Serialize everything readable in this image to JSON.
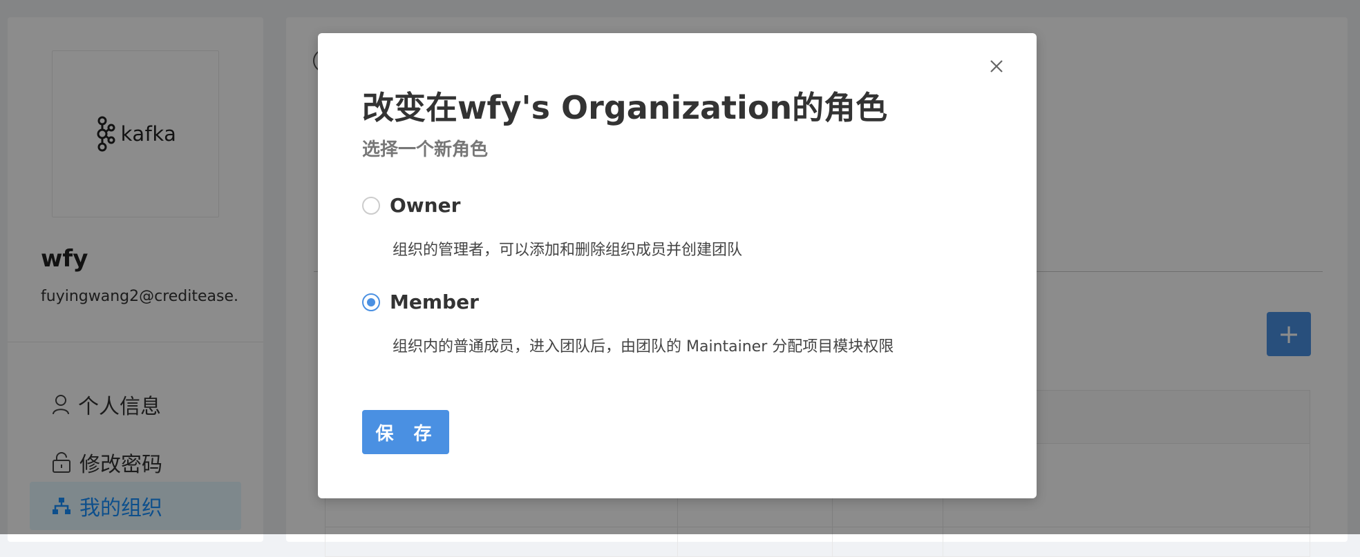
{
  "sidebar": {
    "logo_text": "kafka",
    "user_name": "wfy",
    "user_email": "fuyingwang2@creditease.",
    "items": [
      {
        "label": "个人信息",
        "icon": "user-icon"
      },
      {
        "label": "修改密码",
        "icon": "lock-icon"
      },
      {
        "label": "我的组织",
        "icon": "organization-icon",
        "active": true
      }
    ]
  },
  "main": {
    "add_label": "+"
  },
  "modal": {
    "title": "改变在wfy's Organization的角色",
    "subtitle": "选择一个新角色",
    "options": [
      {
        "name": "Owner",
        "description": "组织的管理者，可以添加和删除组织成员并创建团队",
        "selected": false
      },
      {
        "name": "Member",
        "description": "组织内的普通成员，进入团队后，由团队的 Maintainer 分配项目模块权限",
        "selected": true
      }
    ],
    "save_label": "保 存",
    "close_icon": "close-icon"
  },
  "colors": {
    "primary": "#4a90e2",
    "overlay": "rgba(0,0,0,0.45)",
    "active_menu_bg": "#e6f7ff"
  }
}
